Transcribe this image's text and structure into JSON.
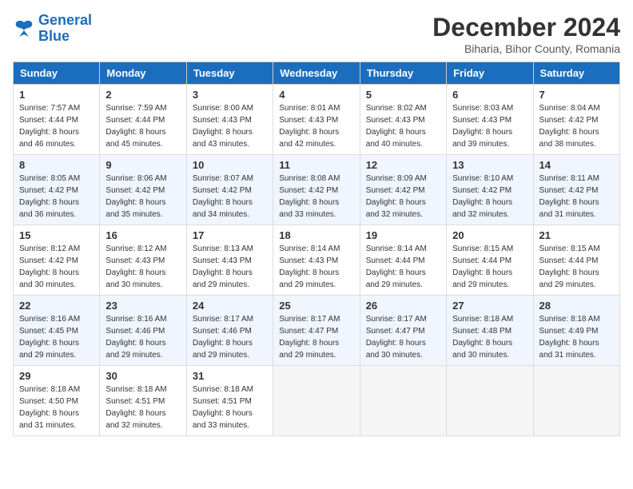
{
  "header": {
    "logo_line1": "General",
    "logo_line2": "Blue",
    "main_title": "December 2024",
    "subtitle": "Biharia, Bihor County, Romania"
  },
  "calendar": {
    "days_of_week": [
      "Sunday",
      "Monday",
      "Tuesday",
      "Wednesday",
      "Thursday",
      "Friday",
      "Saturday"
    ],
    "weeks": [
      [
        {
          "day": "1",
          "info": "Sunrise: 7:57 AM\nSunset: 4:44 PM\nDaylight: 8 hours and 46 minutes."
        },
        {
          "day": "2",
          "info": "Sunrise: 7:59 AM\nSunset: 4:44 PM\nDaylight: 8 hours and 45 minutes."
        },
        {
          "day": "3",
          "info": "Sunrise: 8:00 AM\nSunset: 4:43 PM\nDaylight: 8 hours and 43 minutes."
        },
        {
          "day": "4",
          "info": "Sunrise: 8:01 AM\nSunset: 4:43 PM\nDaylight: 8 hours and 42 minutes."
        },
        {
          "day": "5",
          "info": "Sunrise: 8:02 AM\nSunset: 4:43 PM\nDaylight: 8 hours and 40 minutes."
        },
        {
          "day": "6",
          "info": "Sunrise: 8:03 AM\nSunset: 4:43 PM\nDaylight: 8 hours and 39 minutes."
        },
        {
          "day": "7",
          "info": "Sunrise: 8:04 AM\nSunset: 4:42 PM\nDaylight: 8 hours and 38 minutes."
        }
      ],
      [
        {
          "day": "8",
          "info": "Sunrise: 8:05 AM\nSunset: 4:42 PM\nDaylight: 8 hours and 36 minutes."
        },
        {
          "day": "9",
          "info": "Sunrise: 8:06 AM\nSunset: 4:42 PM\nDaylight: 8 hours and 35 minutes."
        },
        {
          "day": "10",
          "info": "Sunrise: 8:07 AM\nSunset: 4:42 PM\nDaylight: 8 hours and 34 minutes."
        },
        {
          "day": "11",
          "info": "Sunrise: 8:08 AM\nSunset: 4:42 PM\nDaylight: 8 hours and 33 minutes."
        },
        {
          "day": "12",
          "info": "Sunrise: 8:09 AM\nSunset: 4:42 PM\nDaylight: 8 hours and 32 minutes."
        },
        {
          "day": "13",
          "info": "Sunrise: 8:10 AM\nSunset: 4:42 PM\nDaylight: 8 hours and 32 minutes."
        },
        {
          "day": "14",
          "info": "Sunrise: 8:11 AM\nSunset: 4:42 PM\nDaylight: 8 hours and 31 minutes."
        }
      ],
      [
        {
          "day": "15",
          "info": "Sunrise: 8:12 AM\nSunset: 4:42 PM\nDaylight: 8 hours and 30 minutes."
        },
        {
          "day": "16",
          "info": "Sunrise: 8:12 AM\nSunset: 4:43 PM\nDaylight: 8 hours and 30 minutes."
        },
        {
          "day": "17",
          "info": "Sunrise: 8:13 AM\nSunset: 4:43 PM\nDaylight: 8 hours and 29 minutes."
        },
        {
          "day": "18",
          "info": "Sunrise: 8:14 AM\nSunset: 4:43 PM\nDaylight: 8 hours and 29 minutes."
        },
        {
          "day": "19",
          "info": "Sunrise: 8:14 AM\nSunset: 4:44 PM\nDaylight: 8 hours and 29 minutes."
        },
        {
          "day": "20",
          "info": "Sunrise: 8:15 AM\nSunset: 4:44 PM\nDaylight: 8 hours and 29 minutes."
        },
        {
          "day": "21",
          "info": "Sunrise: 8:15 AM\nSunset: 4:44 PM\nDaylight: 8 hours and 29 minutes."
        }
      ],
      [
        {
          "day": "22",
          "info": "Sunrise: 8:16 AM\nSunset: 4:45 PM\nDaylight: 8 hours and 29 minutes."
        },
        {
          "day": "23",
          "info": "Sunrise: 8:16 AM\nSunset: 4:46 PM\nDaylight: 8 hours and 29 minutes."
        },
        {
          "day": "24",
          "info": "Sunrise: 8:17 AM\nSunset: 4:46 PM\nDaylight: 8 hours and 29 minutes."
        },
        {
          "day": "25",
          "info": "Sunrise: 8:17 AM\nSunset: 4:47 PM\nDaylight: 8 hours and 29 minutes."
        },
        {
          "day": "26",
          "info": "Sunrise: 8:17 AM\nSunset: 4:47 PM\nDaylight: 8 hours and 30 minutes."
        },
        {
          "day": "27",
          "info": "Sunrise: 8:18 AM\nSunset: 4:48 PM\nDaylight: 8 hours and 30 minutes."
        },
        {
          "day": "28",
          "info": "Sunrise: 8:18 AM\nSunset: 4:49 PM\nDaylight: 8 hours and 31 minutes."
        }
      ],
      [
        {
          "day": "29",
          "info": "Sunrise: 8:18 AM\nSunset: 4:50 PM\nDaylight: 8 hours and 31 minutes."
        },
        {
          "day": "30",
          "info": "Sunrise: 8:18 AM\nSunset: 4:51 PM\nDaylight: 8 hours and 32 minutes."
        },
        {
          "day": "31",
          "info": "Sunrise: 8:18 AM\nSunset: 4:51 PM\nDaylight: 8 hours and 33 minutes."
        },
        null,
        null,
        null,
        null
      ]
    ]
  }
}
